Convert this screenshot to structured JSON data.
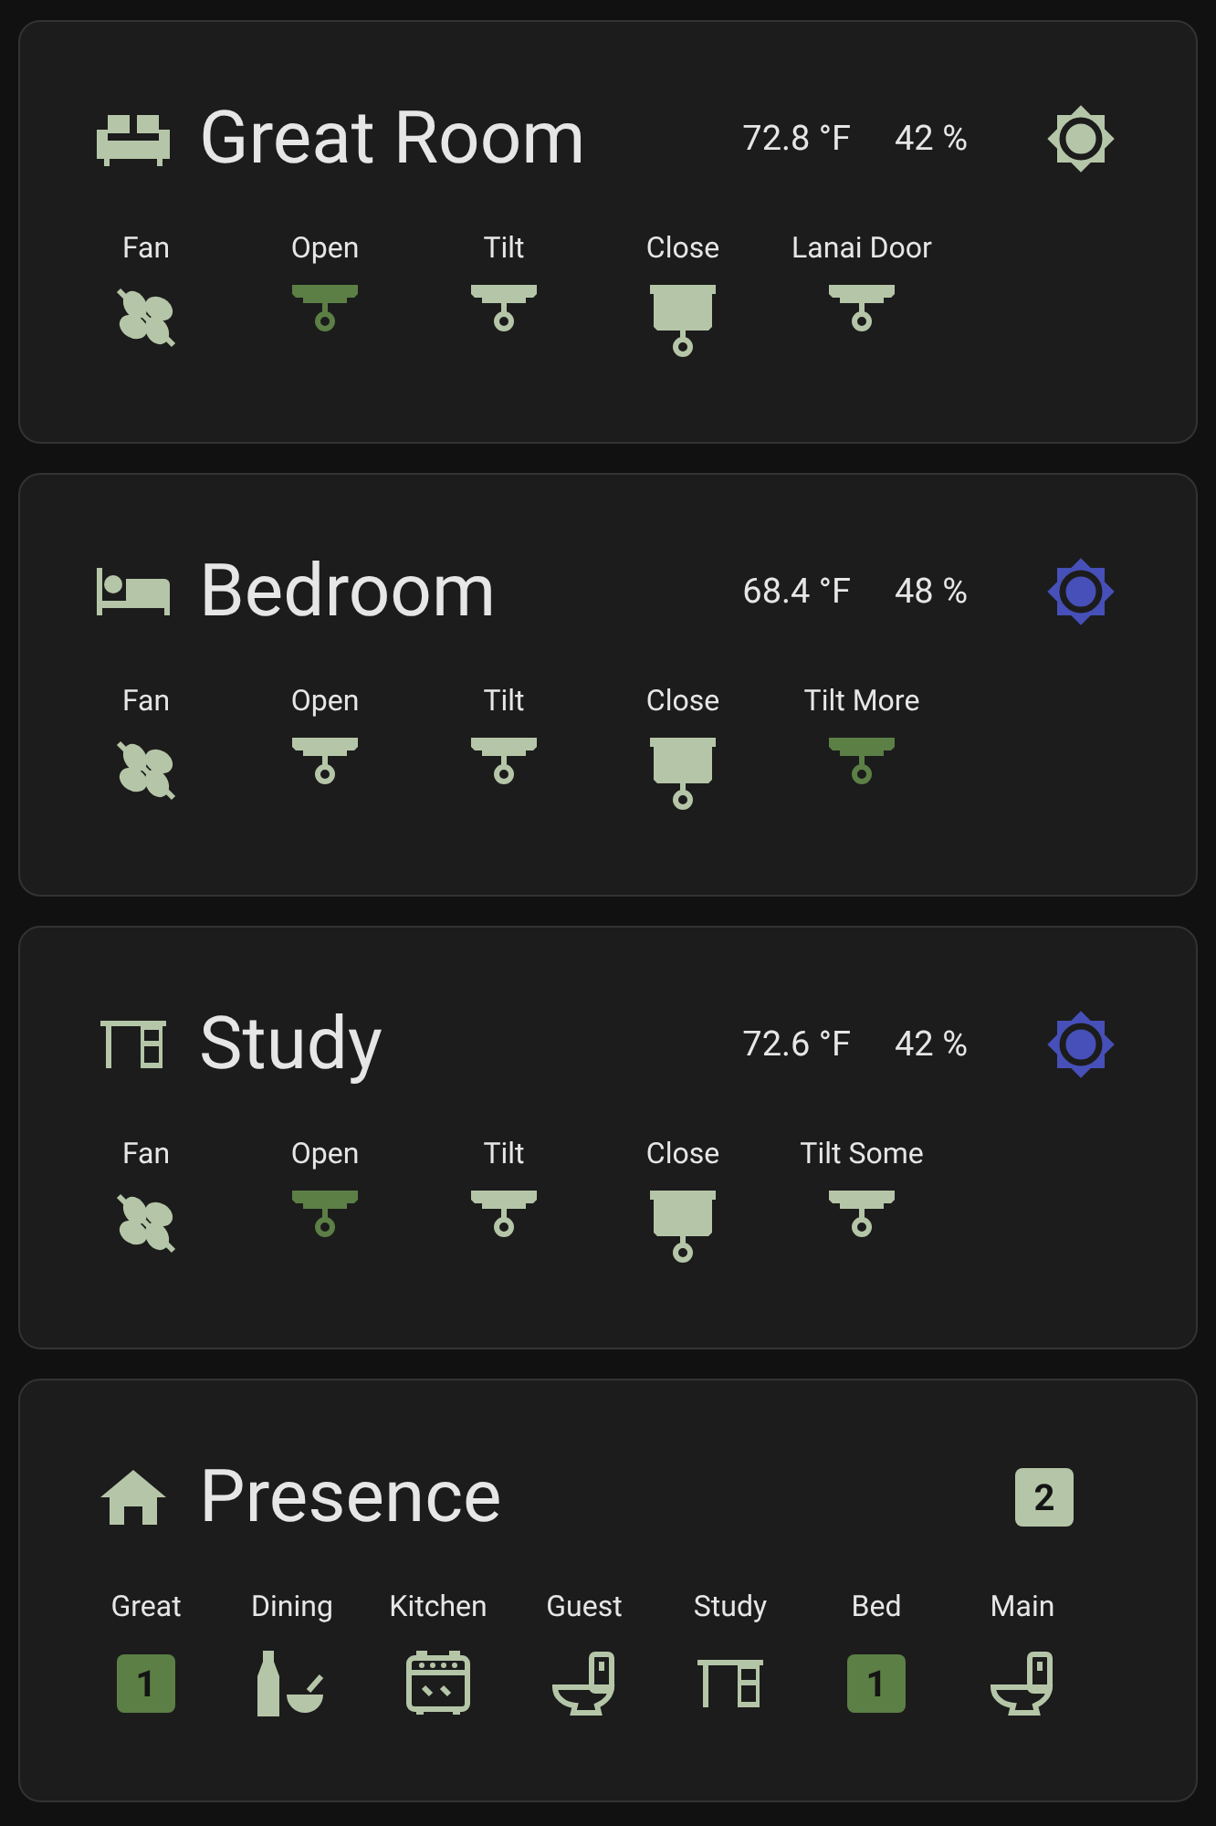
{
  "rooms": [
    {
      "title": "Great Room",
      "kind": "sofa",
      "temperature": "72.8 °F",
      "humidity": "42 %",
      "sun": {
        "color": "#b5c6a8"
      },
      "entities": [
        {
          "label": "Fan",
          "kind": "fan",
          "active": false
        },
        {
          "label": "Open",
          "kind": "tilt",
          "active": true
        },
        {
          "label": "Tilt",
          "kind": "tilt",
          "active": false
        },
        {
          "label": "Close",
          "kind": "closed",
          "active": false
        },
        {
          "label": "Lanai Door",
          "kind": "tilt",
          "active": false
        }
      ]
    },
    {
      "title": "Bedroom",
      "kind": "bed",
      "temperature": "68.4 °F",
      "humidity": "48 %",
      "sun": {
        "color": "#4650b8"
      },
      "entities": [
        {
          "label": "Fan",
          "kind": "fan",
          "active": false
        },
        {
          "label": "Open",
          "kind": "tilt",
          "active": false
        },
        {
          "label": "Tilt",
          "kind": "tilt",
          "active": false
        },
        {
          "label": "Close",
          "kind": "closed",
          "active": false
        },
        {
          "label": "Tilt More",
          "kind": "tilt",
          "active": true
        }
      ]
    },
    {
      "title": "Study",
      "kind": "desk",
      "temperature": "72.6 °F",
      "humidity": "42 %",
      "sun": {
        "color": "#4650b8"
      },
      "entities": [
        {
          "label": "Fan",
          "kind": "fan",
          "active": false
        },
        {
          "label": "Open",
          "kind": "tilt",
          "active": true
        },
        {
          "label": "Tilt",
          "kind": "tilt",
          "active": false
        },
        {
          "label": "Close",
          "kind": "closed",
          "active": false
        },
        {
          "label": "Tilt Some",
          "kind": "tilt",
          "active": false
        }
      ]
    }
  ],
  "presence": {
    "title": "Presence",
    "total": "2",
    "items": [
      {
        "label": "Great",
        "kind": "count",
        "value": "1"
      },
      {
        "label": "Dining",
        "kind": "dining"
      },
      {
        "label": "Kitchen",
        "kind": "kitchen"
      },
      {
        "label": "Guest",
        "kind": "toilet"
      },
      {
        "label": "Study",
        "kind": "desk"
      },
      {
        "label": "Bed",
        "kind": "count",
        "value": "1"
      },
      {
        "label": "Main",
        "kind": "toilet"
      }
    ]
  }
}
